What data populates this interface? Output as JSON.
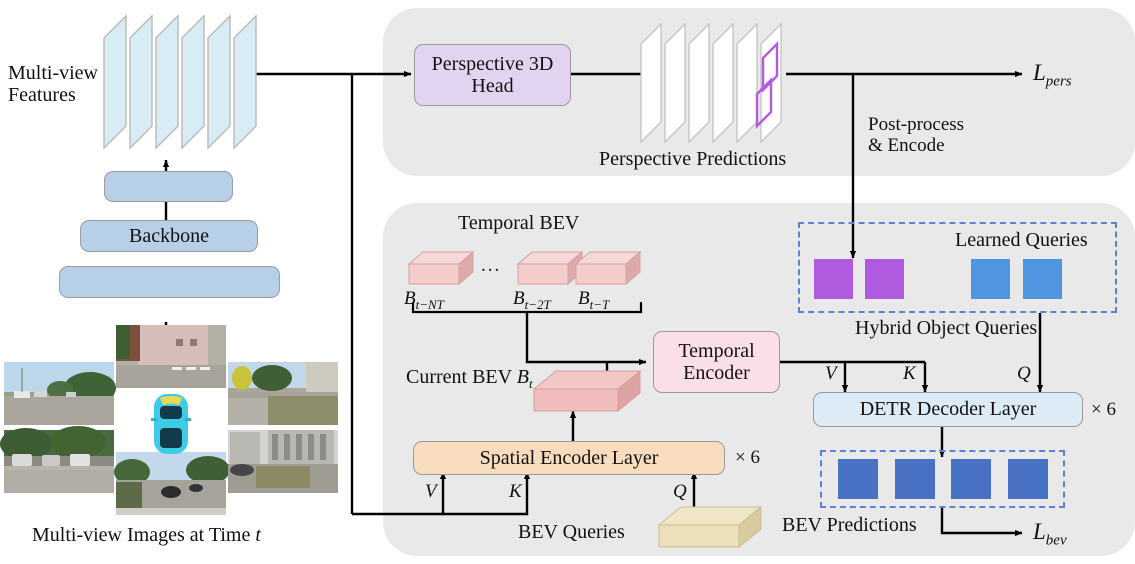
{
  "figure": {
    "title": "Multi-view 3D detection architecture with perspective and BEV branches",
    "type": "diagram"
  },
  "left_branch": {
    "multi_view_features_label_line1": "Multi-view",
    "multi_view_features_label_line2": "Features",
    "feature_plane_count": 6,
    "neck_top_label": "",
    "backbone_label": "Backbone",
    "neck_bottom_label": "",
    "images_caption_plain": "Multi-view Images at Time ",
    "images_caption_italic": "t",
    "camera_view_count": 6,
    "ego_vehicle_icon": "car-top-view-icon"
  },
  "perspective_panel": {
    "head_label_line1": "Perspective 3D",
    "head_label_line2": "Head",
    "predictions_caption": "Perspective Predictions",
    "prediction_plane_count": 6,
    "detection_box_count": 2,
    "post_process_line1": "Post-process",
    "post_process_line2": "& Encode",
    "loss_label_base": "L",
    "loss_label_sub": "pers"
  },
  "bev_panel": {
    "temporal_bev_title": "Temporal BEV",
    "temporal_ellipsis": "...",
    "temporal_items": [
      {
        "base": "B",
        "sub": "t−NT"
      },
      {
        "base": "B",
        "sub": "t−2T"
      },
      {
        "base": "B",
        "sub": "t−T"
      }
    ],
    "current_bev_label_plain": "Current BEV ",
    "current_bev_label_base": "B",
    "current_bev_label_sub": "t",
    "temporal_encoder_line1": "Temporal",
    "temporal_encoder_line2": "Encoder",
    "spatial_encoder_label": "Spatial Encoder Layer",
    "spatial_encoder_repeat": "× 6",
    "bev_queries_label": "BEV Queries",
    "spatial_inputs": {
      "v": "V",
      "k": "K",
      "q": "Q"
    }
  },
  "decoder_panel": {
    "learned_queries_label": "Learned Queries",
    "hybrid_object_queries_label": "Hybrid Object Queries",
    "perspective_query_count": 2,
    "learned_query_count": 2,
    "decoder_label": "DETR Decoder Layer",
    "decoder_repeat": "× 6",
    "decoder_inputs": {
      "v": "V",
      "k": "K",
      "q": "Q"
    },
    "bev_predictions_label": "BEV Predictions",
    "bev_prediction_count": 4,
    "loss_label_base": "L",
    "loss_label_sub": "bev"
  },
  "colors": {
    "panel_bg": "#e9e9e9",
    "feature_plane": "#d8ecf6",
    "backbone_box": "#b8cfe8",
    "perspective_head": "#e2d4f0",
    "temporal_encoder": "#fadfe6",
    "spatial_encoder": "#f8dcbe",
    "bev_slab": "#f2c3c3",
    "bev_queries_block": "#ece0bb",
    "perspective_query": "#b05ae0",
    "learned_query": "#4f95e0",
    "bev_prediction": "#4a72c4",
    "detr_box": "#dcebf5",
    "detection_outline": "#b45ae0",
    "dashed_border": "#5b84d6"
  }
}
